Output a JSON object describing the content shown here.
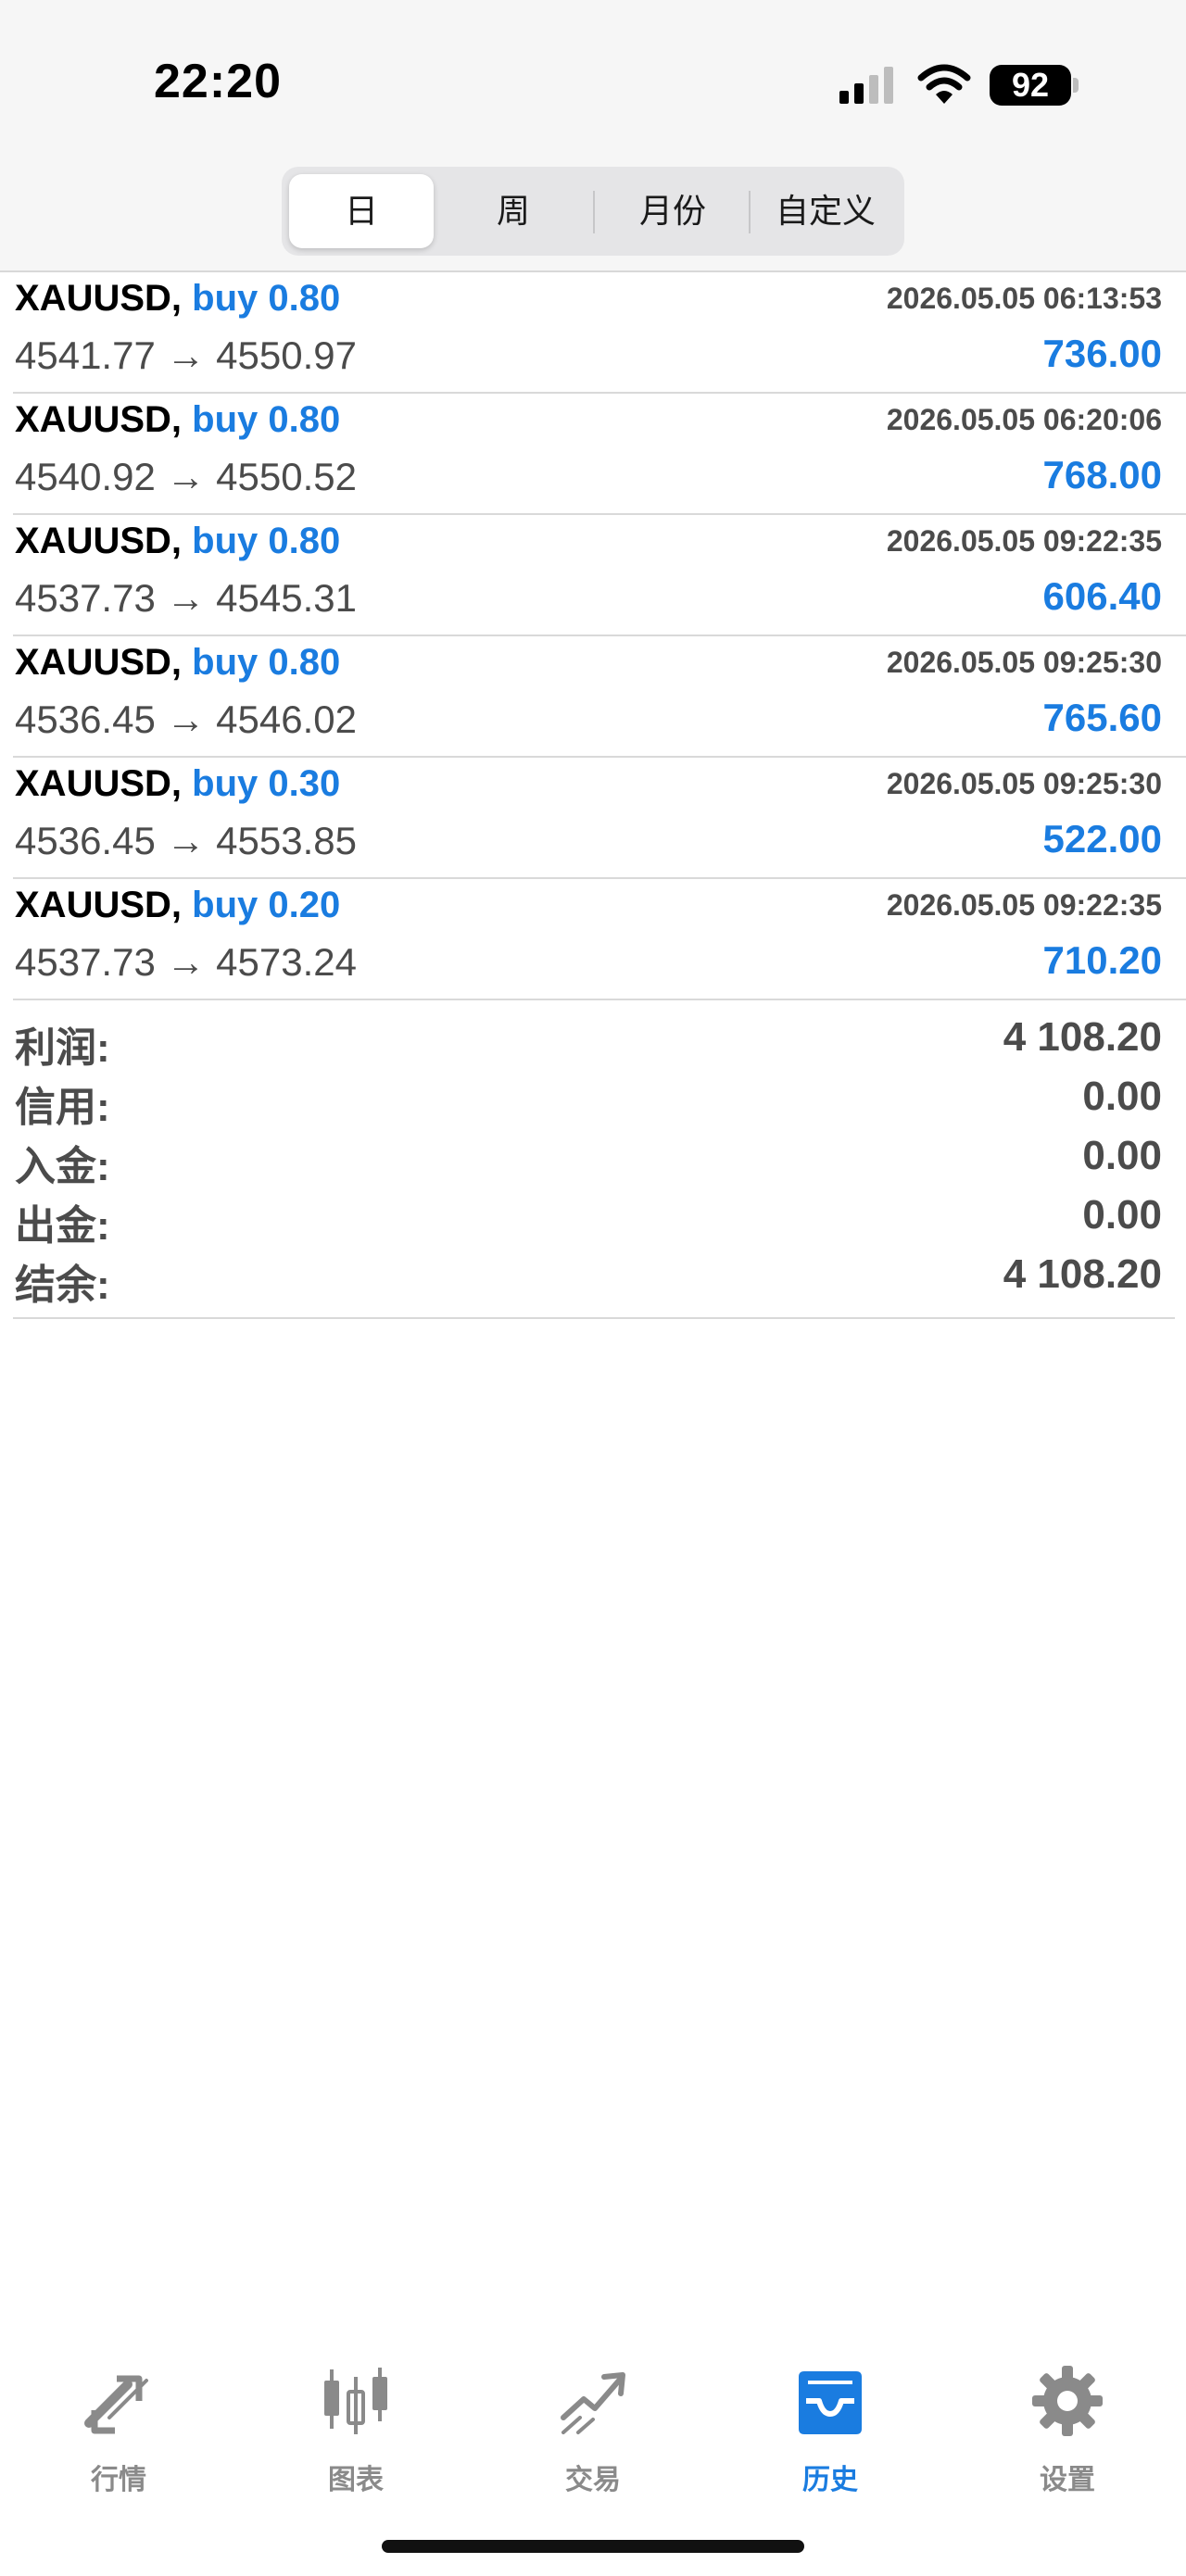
{
  "status_bar": {
    "time": "22:20",
    "battery": "92"
  },
  "period_tabs": [
    {
      "label": "日",
      "active": true
    },
    {
      "label": "周",
      "active": false
    },
    {
      "label": "月份",
      "active": false
    },
    {
      "label": "自定义",
      "active": false
    }
  ],
  "deals": [
    {
      "symbol": "XAUUSD,",
      "side": "buy 0.80",
      "time": "2026.05.05 06:13:53",
      "prices": "4541.77 → 4550.97",
      "profit": "736.00"
    },
    {
      "symbol": "XAUUSD,",
      "side": "buy 0.80",
      "time": "2026.05.05 06:20:06",
      "prices": "4540.92 → 4550.52",
      "profit": "768.00"
    },
    {
      "symbol": "XAUUSD,",
      "side": "buy 0.80",
      "time": "2026.05.05 09:22:35",
      "prices": "4537.73 → 4545.31",
      "profit": "606.40"
    },
    {
      "symbol": "XAUUSD,",
      "side": "buy 0.80",
      "time": "2026.05.05 09:25:30",
      "prices": "4536.45 → 4546.02",
      "profit": "765.60"
    },
    {
      "symbol": "XAUUSD,",
      "side": "buy 0.30",
      "time": "2026.05.05 09:25:30",
      "prices": "4536.45 → 4553.85",
      "profit": "522.00"
    },
    {
      "symbol": "XAUUSD,",
      "side": "buy 0.20",
      "time": "2026.05.05 09:22:35",
      "prices": "4537.73 → 4573.24",
      "profit": "710.20"
    }
  ],
  "summary": [
    {
      "label": "利润:",
      "value": "4 108.20"
    },
    {
      "label": "信用:",
      "value": "0.00"
    },
    {
      "label": "入金:",
      "value": "0.00"
    },
    {
      "label": "出金:",
      "value": "0.00"
    },
    {
      "label": "结余:",
      "value": "4 108.20"
    }
  ],
  "tab_bar": [
    {
      "label": "行情",
      "icon": "quotes-arrows-icon",
      "active": false
    },
    {
      "label": "图表",
      "icon": "candlestick-chart-icon",
      "active": false
    },
    {
      "label": "交易",
      "icon": "trade-trend-icon",
      "active": false
    },
    {
      "label": "历史",
      "icon": "history-inbox-icon",
      "active": true
    },
    {
      "label": "设置",
      "icon": "gear-icon",
      "active": false
    }
  ],
  "colors": {
    "accent": "#1a7ce0",
    "text_muted": "#4b4b4b",
    "tab_inactive": "#8a8a8a"
  }
}
